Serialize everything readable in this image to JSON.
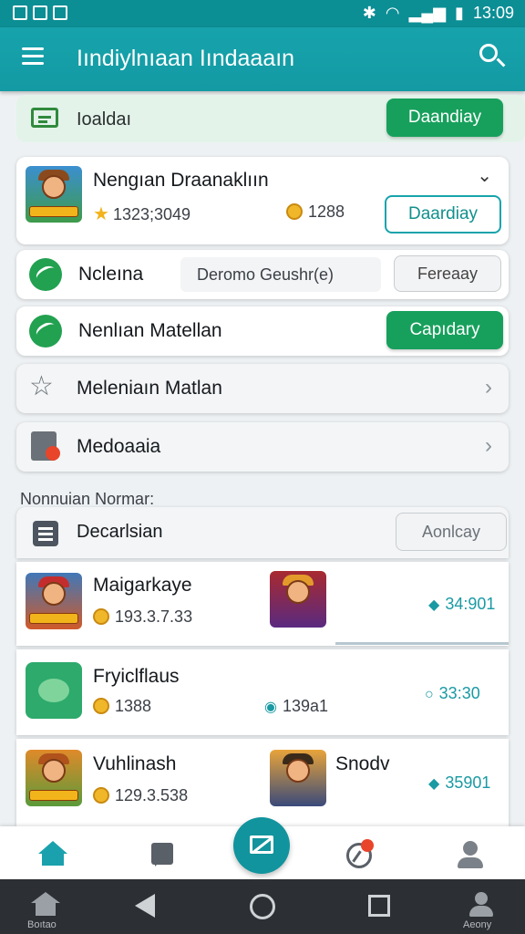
{
  "status_bar": {
    "left_icons": [
      "notification-icon",
      "sim-icon",
      "photo-icon"
    ],
    "time": "13:09"
  },
  "app_bar": {
    "title": "Iındiylnıaan Iındaaaın"
  },
  "banner": {
    "label": "Ioaldaı",
    "button": "Daandiay"
  },
  "featured": {
    "title": "Nengıan Draanaklıın",
    "stars": "1323;3049",
    "coins": "1288",
    "button": "Daardiay"
  },
  "rows": [
    {
      "label": "Ncleına",
      "field": "Deromo Geushr(e)",
      "button": "Fereaay"
    },
    {
      "label": "Nenlıan Matellan",
      "button": "Capıdary"
    },
    {
      "label": "Meleniaın Matlan"
    },
    {
      "label": "Medoaaia"
    }
  ],
  "section": {
    "title": "Nonnuian Normar:",
    "list_label": "Decarlsian",
    "list_button": "Aonlcay"
  },
  "games": [
    {
      "title": "Maigarkaye",
      "sub": "193.3.7.33",
      "right_badge": "34:901",
      "progress": 0.0
    },
    {
      "title": "Fryiclflaus",
      "sub": "1388",
      "mid_badge": "139a1",
      "right_badge": "33:30"
    },
    {
      "title": "Vuhlinash",
      "sub": "129.3.538",
      "second_title": "Snodv",
      "right_badge": "35901"
    }
  ],
  "bottom_nav": [
    "home-icon",
    "chat-icon",
    "compose-icon",
    "compass-icon",
    "profile-icon"
  ],
  "system_nav": {
    "home_label": "Boıtao",
    "profile_label": "Aeony"
  },
  "colors": {
    "accent": "#17a3ac",
    "green": "#17a05c"
  }
}
